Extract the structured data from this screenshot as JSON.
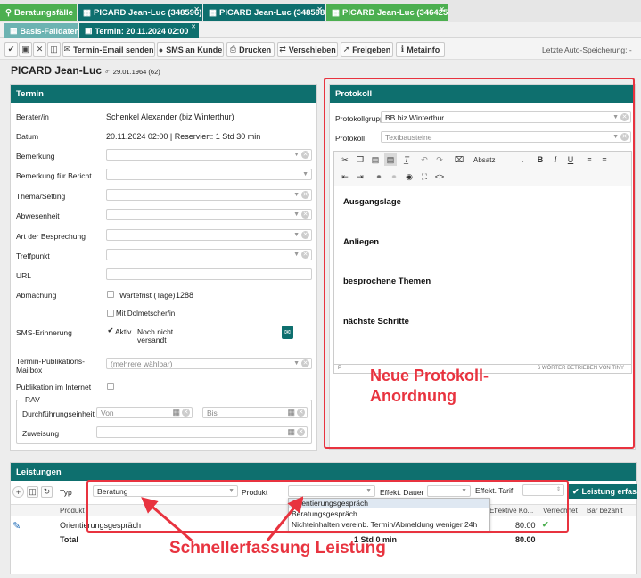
{
  "tabs": [
    {
      "label": "Beratungsfälle",
      "icon": "search-icon",
      "color": "#4caf50"
    },
    {
      "label": "PICARD Jean-Luc (348596)",
      "icon": "grid-icon",
      "color": "#0e6f6e"
    },
    {
      "label": "PICARD Jean-Luc (348598)",
      "icon": "grid-icon",
      "color": "#0e6f6e"
    },
    {
      "label": "PICARD Jean-Luc (346425)",
      "icon": "grid-icon",
      "color": "#4caf50"
    }
  ],
  "subtabs": [
    {
      "label": "Basis-Falldaten",
      "color": "#6cb3b2"
    },
    {
      "label": "Termin: 20.11.2024 02:00",
      "color": "#0e6f6e"
    }
  ],
  "toolbar": {
    "email_label": "Termin-Email senden",
    "sms_label": "SMS an Kunde",
    "print_label": "Drucken",
    "move_label": "Verschieben",
    "release_label": "Freigeben",
    "meta_label": "Metainfo",
    "autosave": "Letzte Auto-Speicherung: -"
  },
  "person": {
    "name": "PICARD Jean-Luc",
    "gender": "♂",
    "birth": "29.01.1964 (62)"
  },
  "termin": {
    "title": "Termin",
    "berater_label": "Berater/in",
    "berater_value": "Schenkel Alexander (biz Winterthur)",
    "datum_label": "Datum",
    "datum_value": "20.11.2024 02:00 | Reserviert: 1 Std 30 min",
    "bemerkung_label": "Bemerkung",
    "bemerkung_bericht_label": "Bemerkung für Bericht",
    "thema_label": "Thema/Setting",
    "abwesenheit_label": "Abwesenheit",
    "art_label": "Art der Besprechung",
    "treffpunkt_label": "Treffpunkt",
    "url_label": "URL",
    "abmachung_label": "Abmachung",
    "wartefrist_label": "Wartefrist (Tage)",
    "wartefrist_value": "1288",
    "dolmetscher_label": "Mit Dolmetscher/in",
    "sms_label": "SMS-Erinnerung",
    "aktiv_label": "Aktiv",
    "sms_status_1": "Noch nicht",
    "sms_status_2": "versandt",
    "publikation_label_1": "Termin-Publikations-",
    "publikation_label_2": "Mailbox",
    "publikation_placeholder": "(mehrere wählbar)",
    "internet_label": "Publikation im Internet",
    "rav_label": "RAV",
    "durchfuehrung_label": "Durchführungseinheit",
    "von_placeholder": "Von",
    "bis_placeholder": "Bis",
    "zuweisung_label": "Zuweisung"
  },
  "protokoll": {
    "title": "Protokoll",
    "gruppe_label": "Protokollgrupp",
    "gruppe_value": "BB biz Winterthur",
    "protokoll_label": "Protokoll",
    "protokoll_placeholder": "Textbausteine",
    "format_value": "Absatz",
    "headings": [
      "Ausgangslage",
      "Anliegen",
      "besprochene Themen",
      "nächste Schritte"
    ],
    "status_left": "P",
    "status_right": "6 WÖRTER  BETRIEBEN VON TINY"
  },
  "annotations": {
    "protokoll_1": "Neue Protokoll-",
    "protokoll_2": "Anordnung",
    "leistung": "Schnellerfassung Leistung"
  },
  "leistungen": {
    "title": "Leistungen",
    "typ_label": "Typ",
    "typ_value": "Beratung",
    "produkt_label": "Produkt",
    "dauer_label": "Effekt. Dauer",
    "tarif_label": "Effekt. Tarif",
    "erfassen_label": "Leistung erfass",
    "dropdown_options": [
      "Orientierungsgespräch",
      "Beratungsgespräch",
      "Nichteinhalten vereinb. Termin/Abmeldung weniger 24h"
    ],
    "columns": [
      "Produkt",
      "Effektive Ko...",
      "Verrechnet",
      "Bar bezahlt"
    ],
    "rows": [
      {
        "produkt": "Orientierungsgespräch",
        "kosten": "80.00",
        "verrechnet": "✔"
      }
    ],
    "total_label": "Total",
    "total_dauer": "1 Std 0 min",
    "total_kosten": "80.00"
  },
  "colors": {
    "accent": "#0e6f6e",
    "green": "#4caf50",
    "annotation": "#e8333f"
  }
}
